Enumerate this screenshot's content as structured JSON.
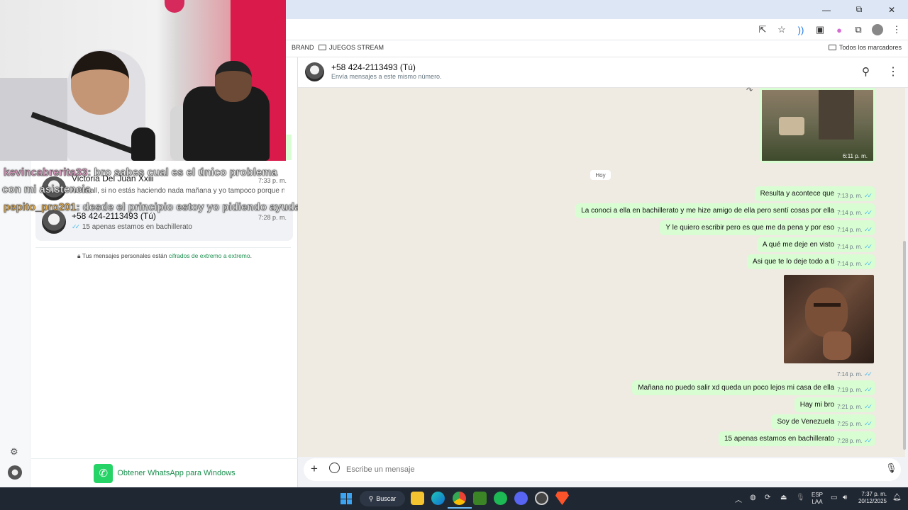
{
  "browser": {
    "window_controls": {
      "minimize": "—",
      "maximize": "⧉",
      "close": "✕"
    },
    "bookmarks": [
      {
        "label": "BRAND"
      },
      {
        "label": "JUEGOS STREAM"
      }
    ],
    "all_bookmarks_label": "Todos los marcadores"
  },
  "stream_overlay": {
    "lines": [
      {
        "user": "kevincabrerita33",
        "message": ": bro sabes cual es el único problema"
      },
      {
        "user": "",
        "message": "con mi asistencia"
      },
      {
        "user": "pepito_pro201",
        "message": ": desde el principio estoy yo pidiendo ayuda"
      }
    ]
  },
  "chat_list": [
    {
      "name": "Victoria Del Juan Xxiii",
      "time": "7:33 p. m.",
      "snippet": "Abnmall, si no estás haciendo nada mañana y yo tampoco porque n..."
    },
    {
      "name": "+58 424-2113493 (Tú)",
      "time": "7:28 p. m.",
      "snippet": "15 apenas estamos en bachillerato"
    }
  ],
  "encrypted_notice": {
    "prefix": "Tus mensajes personales están",
    "link": "cifrados de extremo a extremo",
    "suffix": "."
  },
  "get_whatsapp": "Obtener WhatsApp para Windows",
  "chat_header": {
    "title": "+58 424-2113493 (Tú)",
    "subtitle": "Envía mensajes a este mismo número."
  },
  "messages": {
    "image1_time": "6:11 p. m.",
    "day_chip": "Hoy",
    "texts": [
      {
        "text": "Resulta y acontece que",
        "time": "7:13 p. m."
      },
      {
        "text": "La conoci a ella  en bachillerato y me hize amigo de ella pero sentí cosas por ella",
        "time": "7:14 p. m."
      },
      {
        "text": "Y le quiero escribir pero es que me da pena y por eso",
        "time": "7:14 p. m."
      },
      {
        "text": "A qué me deje en visto",
        "time": "7:14 p. m."
      },
      {
        "text": "Asi que te lo deje todo a ti",
        "time": "7:14 p. m."
      }
    ],
    "image2_time": "7:14 p. m.",
    "texts_after": [
      {
        "text": "Mañana no puedo salir xd queda un poco lejos mi casa de ella",
        "time": "7:19 p. m."
      },
      {
        "text": "Hay mi bro",
        "time": "7:21 p. m."
      },
      {
        "text": "Soy de Venezuela",
        "time": "7:25 p. m."
      },
      {
        "text": "15 apenas estamos en bachillerato",
        "time": "7:28 p. m."
      }
    ]
  },
  "composer": {
    "placeholder": "Escribe un mensaje"
  },
  "taskbar": {
    "search_label": "Buscar",
    "language": "ESP",
    "language_sub": "LAA",
    "time": "7:37 p. m.",
    "date": "20/12/2025"
  },
  "colors": {
    "bubble_out": "#d9fdd3",
    "chat_bg": "#efeae2",
    "accent_green": "#25d366",
    "tick_blue": "#53bdeb"
  }
}
